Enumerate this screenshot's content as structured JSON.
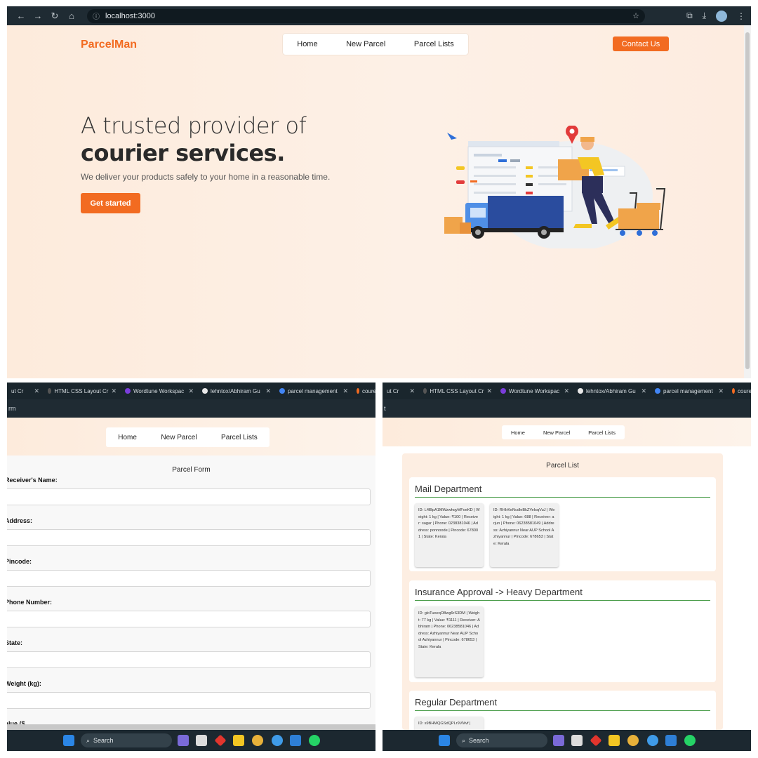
{
  "browser": {
    "url": "localhost:3000",
    "nav_back": "←",
    "nav_forward": "→",
    "nav_reload": "↻",
    "nav_home": "⌂",
    "info_icon": "ⓘ",
    "star_icon": "☆",
    "ext_icon": "⧉",
    "download_icon": "⤓",
    "menu_icon": "⋮"
  },
  "site": {
    "logo": "ParcelMan",
    "nav": [
      "Home",
      "New Parcel",
      "Parcel Lists"
    ],
    "contact": "Contact Us",
    "headline_light": "A trusted provider of",
    "headline_bold": "courier services.",
    "subtext": "We deliver your products safely to your home in a reasonable time.",
    "cta": "Get started"
  },
  "tabs": [
    {
      "label": "ut Cr",
      "color": "#7a6ad8"
    },
    {
      "label": "HTML CSS Layout Cr",
      "color": "#555555"
    },
    {
      "label": "Wordtune Workspac",
      "color": "#7a3ddb"
    },
    {
      "label": "lehntox/Abhiram Gu",
      "color": "#e8e8e8"
    },
    {
      "label": "parcel management",
      "color": "#4285f4"
    },
    {
      "label": "coure",
      "color": "#f26b21"
    }
  ],
  "left_panel": {
    "address_fragment": "rm",
    "form_title": "Parcel Form",
    "fields": [
      "Receiver's Name:",
      "Address:",
      "Pincode:",
      "Phone Number:",
      "State:",
      "Weight (kg):"
    ],
    "cut_field": "alue ($"
  },
  "right_panel": {
    "address_fragment": "t",
    "list_title": "Parcel List",
    "departments": [
      {
        "name": "Mail Department",
        "parcels": [
          "ID: L4lBpA1MWzwhqyMFoeKD | Weight: 1 kg | Value: ₹100 | Receiver: sagar | Phone: 0238381046 | Address: ponnoode | Pincode: 678001 | State: Kerala",
          "ID: RHIrKeNcdleBkZYeIsqVuJ | Weight: 1 kg | Value: 688 | Receiver: arjun | Phone: 06238581049 | Address: Azhiyannur Near AUP School Azhiyannur | Pincode: 678653 | State: Kerala"
        ]
      },
      {
        "name": "Insurance Approval -> Heavy Department",
        "parcels": [
          "ID: gloTuoeqO8wg6rS3DM | Weight: 77 kg | Value: ₹1111 | Receiver: Abhiram | Phone: 06238581046 | Address: Azhiyannur Near AUP School Azhiyannur | Pincode: 678653 | State: Kerala"
        ]
      },
      {
        "name": "Regular Department",
        "parcels": [
          "ID: s9BHMQGSdQPLr9VMvf |"
        ]
      }
    ]
  },
  "taskbar": {
    "search": "Search",
    "search_icon": "⌕"
  },
  "colors": {
    "accent": "#f26b21",
    "hero_bg": "#fdeee2",
    "dept_line": "#4a9d4a",
    "chrome_dark": "#1f2b33"
  }
}
